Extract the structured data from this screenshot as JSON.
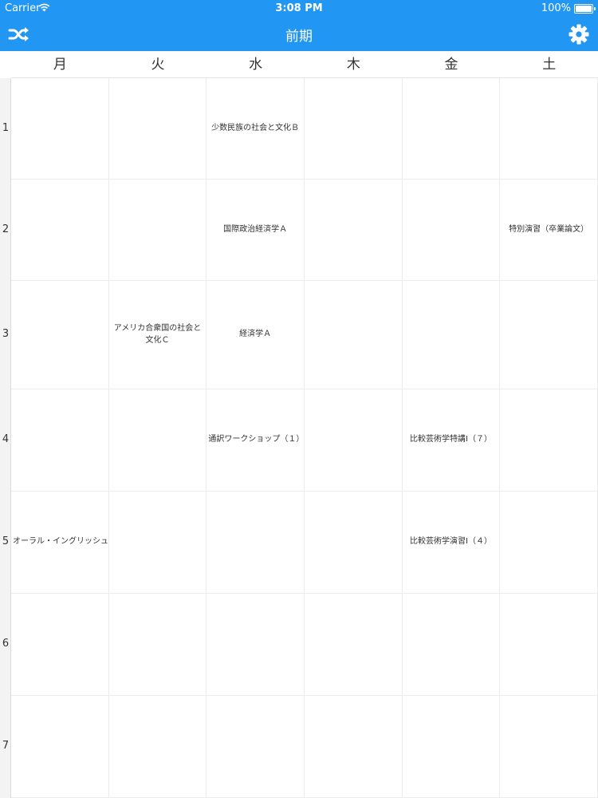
{
  "status_bar": {
    "carrier": "Carrier",
    "time": "3:08 PM",
    "battery": "100%"
  },
  "nav": {
    "title": "前期",
    "left_icon": "shuffle-icon",
    "right_icon": "gear-icon",
    "accent_color": "#2196f3"
  },
  "days": [
    "月",
    "火",
    "水",
    "木",
    "金",
    "土"
  ],
  "periods": [
    "1",
    "2",
    "3",
    "4",
    "5",
    "6",
    "7"
  ],
  "timetable": [
    [
      "",
      "",
      "少数民族の社会と文化Ｂ",
      "",
      "",
      ""
    ],
    [
      "",
      "",
      "国際政治経済学Ａ",
      "",
      "",
      "特別演習（卒業論文）"
    ],
    [
      "",
      "アメリカ合衆国の社会と文化Ｃ",
      "経済学Ａ",
      "",
      "",
      ""
    ],
    [
      "",
      "",
      "通訳ワークショップ（１）",
      "",
      "比較芸術学特講Ⅰ（７）",
      ""
    ],
    [
      "オーラル・イングリッシュⅠ",
      "",
      "",
      "",
      "比較芸術学演習Ⅰ（４）",
      ""
    ],
    [
      "",
      "",
      "",
      "",
      "",
      ""
    ],
    [
      "",
      "",
      "",
      "",
      "",
      ""
    ]
  ]
}
